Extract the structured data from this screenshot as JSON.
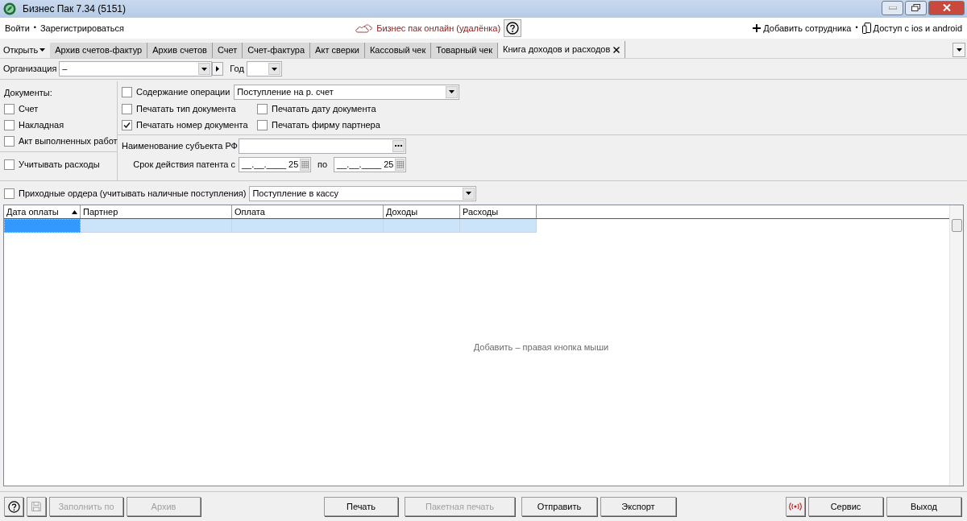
{
  "window": {
    "title": "Бизнес Пак 7.34 (5151)"
  },
  "top_bar": {
    "separators": [
      "•",
      "•"
    ],
    "left_links": [
      "Войти",
      "Зарегистрироваться"
    ],
    "online_link": "Бизнес пак онлайн (удалёнка)",
    "right_links": [
      "Добавить сотрудника",
      "Доступ с ios и android"
    ]
  },
  "tabs": {
    "open_menu": "Открыть",
    "items": [
      {
        "label": "Архив счетов-фактур",
        "selected": false
      },
      {
        "label": "Архив счетов",
        "selected": false
      },
      {
        "label": "Счет",
        "selected": false
      },
      {
        "label": "Счет-фактура",
        "selected": false
      },
      {
        "label": "Акт сверки",
        "selected": false
      },
      {
        "label": "Кассовый чек",
        "selected": false
      },
      {
        "label": "Товарный чек",
        "selected": false
      },
      {
        "label": "Книга доходов и расходов",
        "selected": true
      }
    ]
  },
  "filter": {
    "organization_label": "Организация",
    "organization_value": "–",
    "year_label": "Год"
  },
  "documents": {
    "heading": "Документы:",
    "items": [
      {
        "label": "Счет",
        "checked": false
      },
      {
        "label": "Накладная",
        "checked": false
      },
      {
        "label": "Акт выполненных работ",
        "checked": false
      }
    ],
    "expenses": {
      "label": "Учитывать расходы",
      "checked": false
    }
  },
  "options": {
    "operation": {
      "label": "Содержание операции",
      "checked": false,
      "value": "Поступление на р. счет"
    },
    "print_options": [
      {
        "label": "Печатать тип документа",
        "checked": false
      },
      {
        "label": "Печатать дату документа",
        "checked": false
      },
      {
        "label": "Печатать номер документа",
        "checked": true
      },
      {
        "label": "Печатать фирму партнера",
        "checked": false
      }
    ],
    "subject_label": "Наименование субъекта РФ",
    "patent": {
      "label": "Срок действия патента с",
      "to_label": "по",
      "from_value": "__.__.____",
      "from_day": "25",
      "to_value": "__.__.____",
      "to_day": "25"
    }
  },
  "cash_orders": {
    "label": "Приходные ордера (учитывать наличные поступления)",
    "checked": false,
    "value": "Поступление в кассу"
  },
  "table": {
    "columns": [
      {
        "label": "Дата оплаты",
        "sorted": true
      },
      {
        "label": "Партнер",
        "sorted": false
      },
      {
        "label": "Оплата",
        "sorted": false
      },
      {
        "label": "Доходы",
        "sorted": false
      },
      {
        "label": "Расходы",
        "sorted": false
      }
    ],
    "empty_hint": "Добавить – правая кнопка мыши"
  },
  "bottom_buttons": [
    {
      "label": "Заполнить по",
      "disabled": true
    },
    {
      "label": "Архив",
      "disabled": true
    },
    {
      "label": "Печать",
      "disabled": false
    },
    {
      "label": "Пакетная печать",
      "disabled": true
    },
    {
      "label": "Отправить",
      "disabled": false
    },
    {
      "label": "Экспорт",
      "disabled": false
    },
    {
      "label": "Сервис",
      "disabled": false
    },
    {
      "label": "Выход",
      "disabled": false
    }
  ]
}
